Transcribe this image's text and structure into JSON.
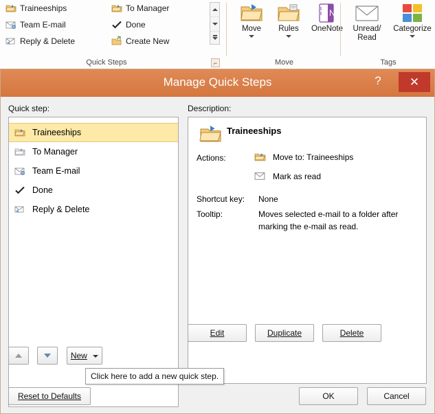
{
  "ribbon": {
    "quick_steps": {
      "group_label": "Quick Steps",
      "items": [
        {
          "label": "Traineeships",
          "icon": "folder-move-icon"
        },
        {
          "label": "To Manager",
          "icon": "folder-move-icon"
        },
        {
          "label": "Team E-mail",
          "icon": "team-email-icon"
        },
        {
          "label": "Done",
          "icon": "checkmark-icon"
        },
        {
          "label": "Reply & Delete",
          "icon": "reply-delete-icon"
        },
        {
          "label": "Create New",
          "icon": "create-new-icon"
        }
      ],
      "dialog_launcher": "⌐"
    },
    "move": {
      "group_label": "Move",
      "buttons": [
        {
          "label": "Move",
          "icon": "move-folder-icon",
          "has_dropdown": true
        },
        {
          "label": "Rules",
          "icon": "rules-icon",
          "has_dropdown": true
        },
        {
          "label": "OneNote",
          "icon": "onenote-icon",
          "has_dropdown": false
        }
      ]
    },
    "tags": {
      "group_label": "Tags",
      "buttons": [
        {
          "label": "Unread/ Read",
          "icon": "envelope-icon",
          "has_dropdown": false
        },
        {
          "label": "Categorize",
          "icon": "categorize-icon",
          "has_dropdown": true
        }
      ]
    }
  },
  "dialog": {
    "title": "Manage Quick Steps",
    "help_glyph": "?",
    "close_glyph": "✕",
    "quick_step_label": "Quick step:",
    "description_label": "Description:",
    "list": [
      {
        "label": "Traineeships",
        "icon": "folder-move-icon",
        "selected": true
      },
      {
        "label": "To Manager",
        "icon": "folder-move-icon",
        "selected": false
      },
      {
        "label": "Team E-mail",
        "icon": "team-email-icon",
        "selected": false
      },
      {
        "label": "Done",
        "icon": "checkmark-icon",
        "selected": false
      },
      {
        "label": "Reply & Delete",
        "icon": "reply-delete-icon",
        "selected": false
      }
    ],
    "description": {
      "heading": "Traineeships",
      "heading_icon": "folder-move-icon",
      "actions_label": "Actions:",
      "actions": [
        {
          "text": "Move to: Traineeships",
          "icon": "folder-move-icon"
        },
        {
          "text": "Mark as read",
          "icon": "mark-read-icon"
        }
      ],
      "shortcut_label": "Shortcut key:",
      "shortcut_value": "None",
      "tooltip_label": "Tooltip:",
      "tooltip_value_line1": "Moves selected e-mail to a folder after",
      "tooltip_value_line2": "marking the e-mail as read."
    },
    "buttons": {
      "edit": "Edit",
      "duplicate": "Duplicate",
      "delete": "Delete",
      "new": "New",
      "reset": "Reset to Defaults",
      "ok": "OK",
      "cancel": "Cancel",
      "move_up": "▲",
      "move_down": "▼"
    },
    "tooltip_popup": "Click here to add a new quick step."
  },
  "colors": {
    "titlebar": "#d4763f",
    "close_button": "#c0392b",
    "selection": "#fde9a8",
    "ribbon_border": "#d3b9a0"
  }
}
